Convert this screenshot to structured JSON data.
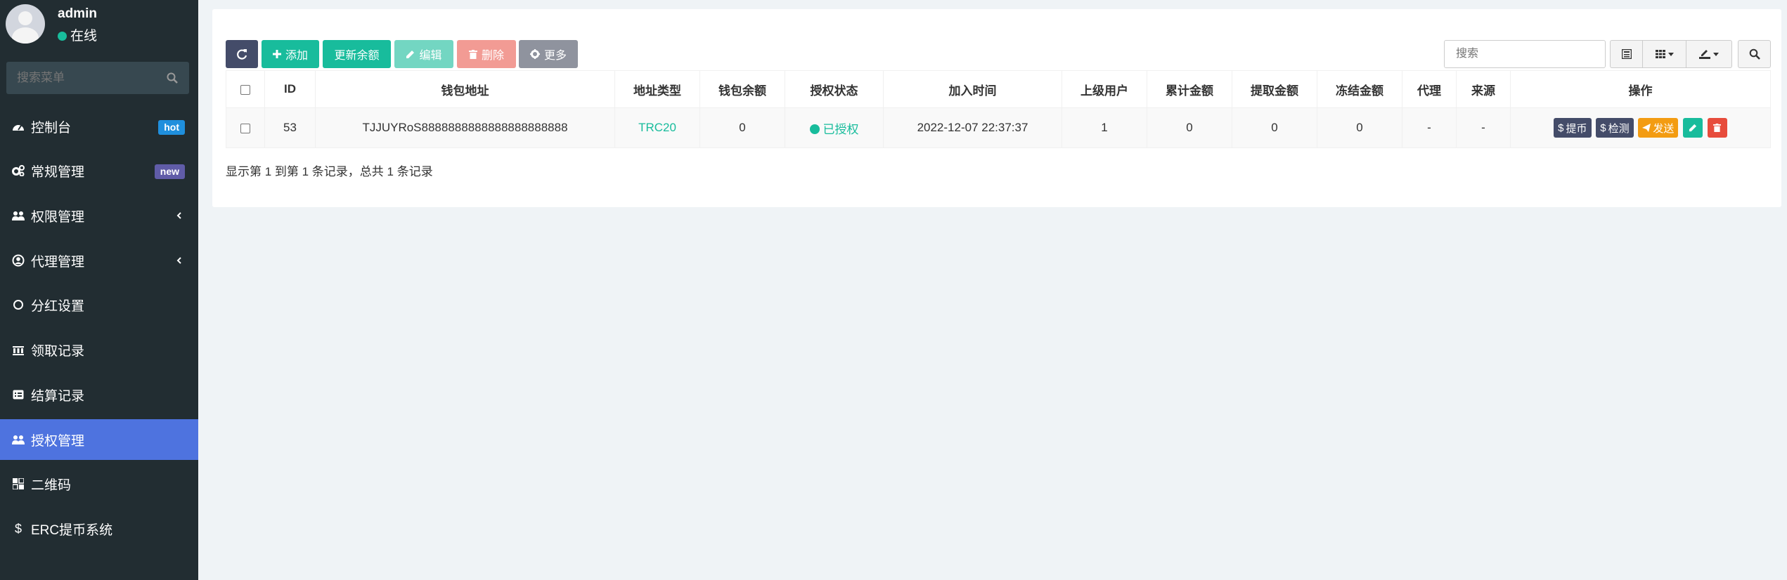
{
  "user": {
    "name": "admin",
    "status": "在线"
  },
  "sidebar": {
    "search_placeholder": "搜索菜单",
    "items": [
      {
        "label": "控制台",
        "icon": "dashboard-icon",
        "badge": "hot"
      },
      {
        "label": "常规管理",
        "icon": "cogs-icon",
        "badge": "new"
      },
      {
        "label": "权限管理",
        "icon": "group-icon"
      },
      {
        "label": "代理管理",
        "icon": "user-circle-icon"
      },
      {
        "label": "分红设置",
        "icon": "circle-icon"
      },
      {
        "label": "领取记录",
        "icon": "bank-icon"
      },
      {
        "label": "结算记录",
        "icon": "list-alt-icon"
      },
      {
        "label": "授权管理",
        "icon": "group-icon"
      },
      {
        "label": "二维码",
        "icon": "qrcode-icon"
      },
      {
        "label": "ERC提币系统",
        "icon": "dollar-icon"
      }
    ]
  },
  "toolbar": {
    "add": "添加",
    "update_balance": "更新余额",
    "edit": "编辑",
    "delete": "删除",
    "more": "更多",
    "search_placeholder": "搜索"
  },
  "table": {
    "headers": [
      "ID",
      "钱包地址",
      "地址类型",
      "钱包余额",
      "授权状态",
      "加入时间",
      "上级用户",
      "累计金额",
      "提取金额",
      "冻结金额",
      "代理",
      "来源",
      "操作"
    ],
    "rows": [
      {
        "id": "53",
        "address": "TJJUYRoS8888888888888888888888",
        "type": "TRC20",
        "balance": "0",
        "status": "已授权",
        "time": "2022-12-07 22:37:37",
        "parent": "1",
        "total": "0",
        "withdrawn": "0",
        "frozen": "0",
        "agent": "-",
        "source": "-"
      }
    ],
    "actions": {
      "withdraw": "提币",
      "check": "检测",
      "send": "发送"
    }
  },
  "pagination": {
    "summary": "显示第 1 到第 1 条记录，总共 1 条记录"
  },
  "colors": {
    "sidebar_bg": "#222d32",
    "active_bg": "#4e73df",
    "accent": "#18bc9c",
    "dark_btn": "#444c69",
    "danger": "#f39c9c",
    "warn": "#f39c12"
  }
}
